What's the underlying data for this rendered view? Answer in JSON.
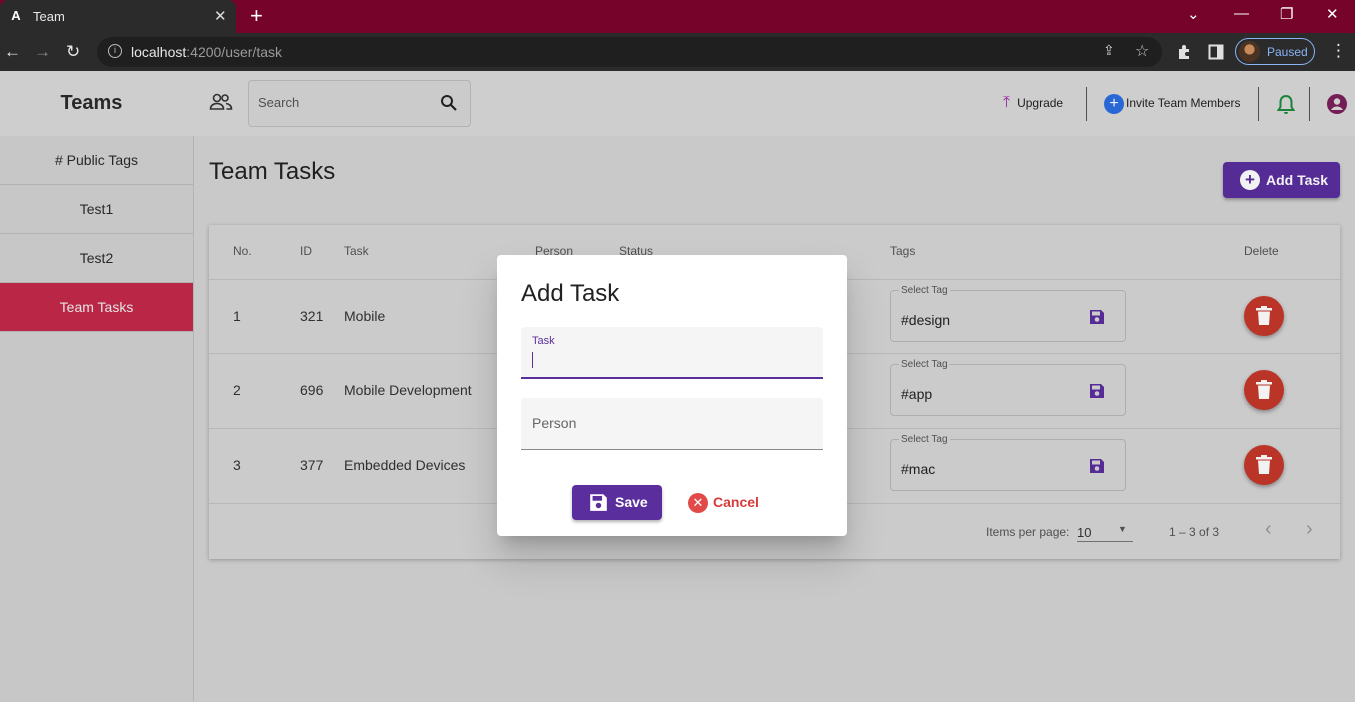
{
  "browser": {
    "tab_title": "Team",
    "url_host": "localhost",
    "url_path": ":4200/user/task",
    "profile_status": "Paused"
  },
  "header": {
    "brand": "Teams",
    "search_placeholder": "Search",
    "upgrade_label": "Upgrade",
    "invite_label": "Invite Team Members"
  },
  "sidebar": {
    "items": [
      {
        "label": "# Public Tags"
      },
      {
        "label": "Test1"
      },
      {
        "label": "Test2"
      },
      {
        "label": "Team Tasks",
        "active": true
      }
    ]
  },
  "main": {
    "title": "Team Tasks",
    "add_task_label": "Add Task",
    "table": {
      "columns": [
        "No.",
        "ID",
        "Task",
        "Person",
        "Status",
        "Tags",
        "Delete"
      ],
      "tag_field_label": "Select Tag",
      "rows": [
        {
          "no": "1",
          "id": "321",
          "task": "Mobile",
          "tag": "#design"
        },
        {
          "no": "2",
          "id": "696",
          "task": "Mobile Development",
          "tag": "#app"
        },
        {
          "no": "3",
          "id": "377",
          "task": "Embedded Devices",
          "tag": "#mac"
        }
      ]
    },
    "paginator": {
      "items_per_page_label": "Items per page:",
      "page_size": "10",
      "range": "1 – 3 of 3"
    }
  },
  "dialog": {
    "title": "Add Task",
    "task_label": "Task",
    "task_value": "",
    "person_placeholder": "Person",
    "save_label": "Save",
    "cancel_label": "Cancel"
  },
  "colors": {
    "accent_purple": "#5a2f9d",
    "active_red": "#c4294a",
    "delete_red": "#c4372b",
    "titlebar": "#75032a"
  }
}
